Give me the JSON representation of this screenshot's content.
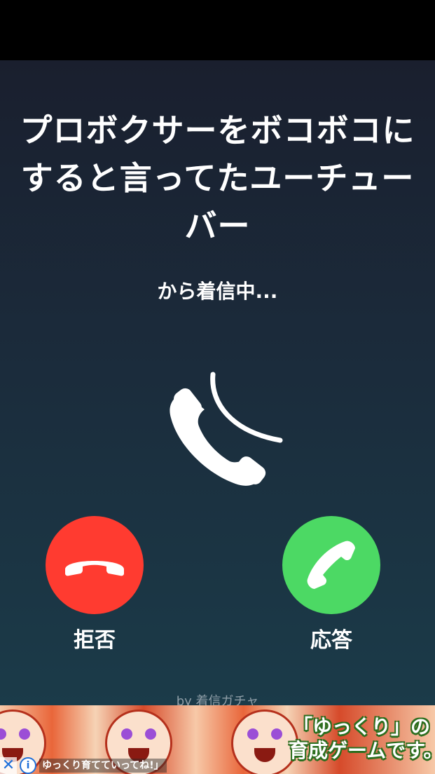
{
  "caller": {
    "name_lines": [
      "プロボクサーをボコボコに",
      "すると言ってたユーチュー",
      "バー"
    ],
    "incoming_text": "から着信中..."
  },
  "actions": {
    "decline_label": "拒否",
    "accept_label": "応答",
    "decline_color": "#ff3b30",
    "accept_color": "#4cd964"
  },
  "credit": "by 着信ガチャ",
  "ad": {
    "headline_lines": [
      "「ゆっくり」の",
      "育成ゲームです。"
    ],
    "tagline": "ゆっくり育てていってね!」",
    "close_icon": "close-icon",
    "info_icon": "info-icon"
  }
}
